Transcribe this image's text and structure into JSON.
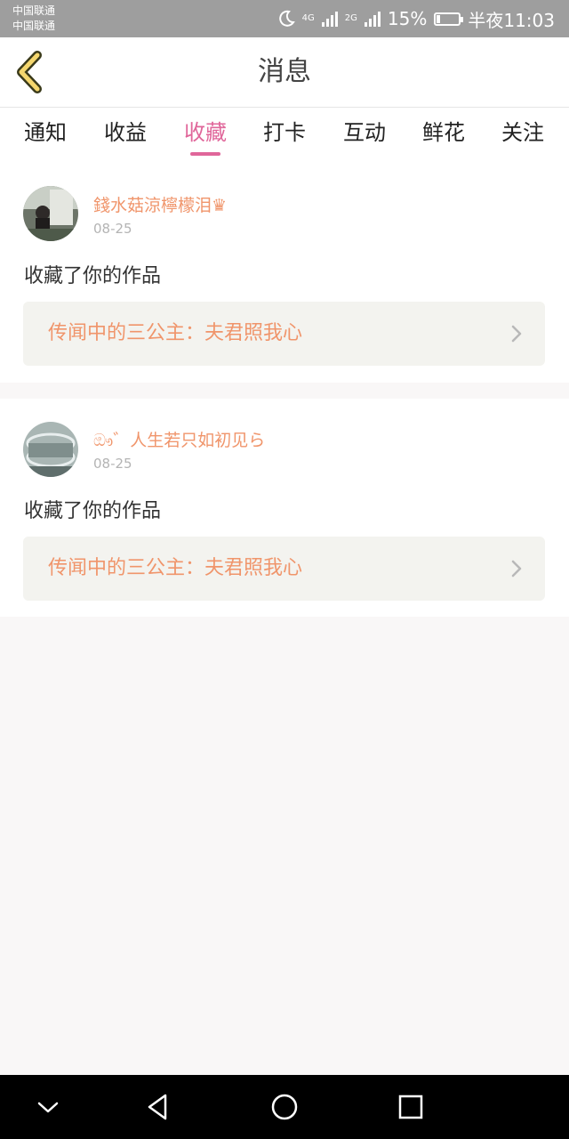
{
  "status_bar": {
    "carrier1": "中国联通",
    "carrier2": "中国联通",
    "net1": "4G",
    "net2": "2G",
    "battery_percent": "15%",
    "battery_level": 0.15,
    "time": "半夜11:03"
  },
  "header": {
    "title": "消息",
    "accent_color": "#e0669a"
  },
  "tabs": [
    {
      "label": "通知",
      "active": false
    },
    {
      "label": "收益",
      "active": false
    },
    {
      "label": "收藏",
      "active": true
    },
    {
      "label": "打卡",
      "active": false
    },
    {
      "label": "互动",
      "active": false
    },
    {
      "label": "鲜花",
      "active": false
    },
    {
      "label": "关注",
      "active": false
    }
  ],
  "messages": [
    {
      "username": "錢水菇涼檸檬泪♛",
      "date": "08-25",
      "action": "收藏了你的作品",
      "work_title": "传闻中的三公主：夫君照我心"
    },
    {
      "username": "ඖ゛人生若只如初见ら",
      "date": "08-25",
      "action": "收藏了你的作品",
      "work_title": "传闻中的三公主：夫君照我心"
    }
  ]
}
